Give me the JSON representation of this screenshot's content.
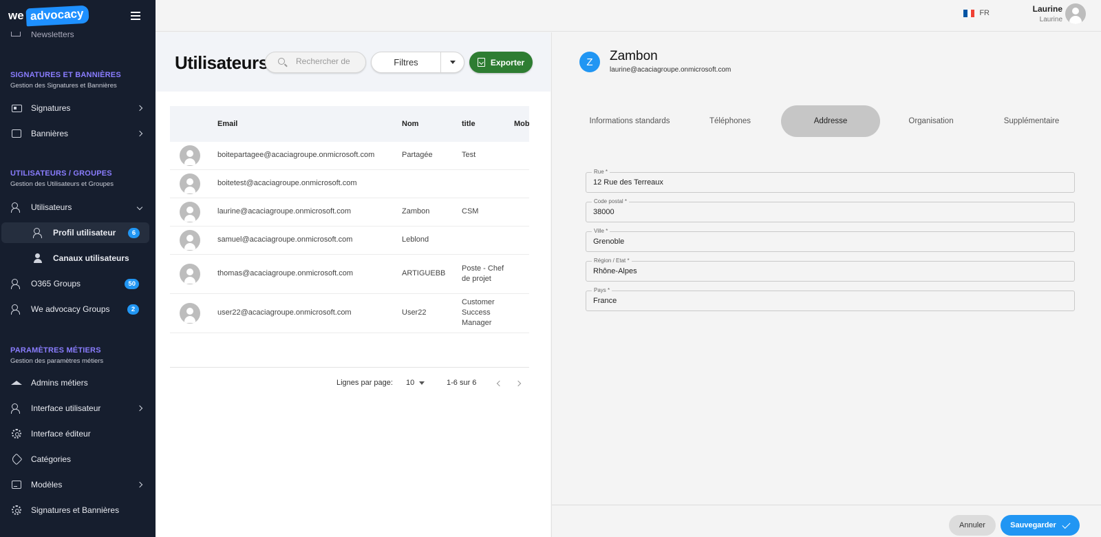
{
  "brand": {
    "we": "we",
    "advocacy": "advocacy"
  },
  "sidebar": {
    "ghost_item": "Newsletters",
    "sections": [
      {
        "heading": "SIGNATURES ET BANNIÈRES",
        "sub": "Gestion des Signatures et Bannières"
      },
      {
        "heading": "UTILISATEURS / GROUPES",
        "sub": "Gestion des Utilisateurs et Groupes"
      },
      {
        "heading": "PARAMÈTRES MÉTIERS",
        "sub": "Gestion des paramètres métiers"
      }
    ],
    "items": {
      "signatures": "Signatures",
      "bannieres": "Bannières",
      "utilisateurs": "Utilisateurs",
      "profil": "Profil utilisateur",
      "profil_badge": "6",
      "canaux": "Canaux utilisateurs",
      "o365": "O365 Groups",
      "o365_badge": "50",
      "wegroups": "We advocacy Groups",
      "wegroups_badge": "2",
      "admins": "Admins métiers",
      "interface_user": "Interface utilisateur",
      "interface_editor": "Interface éditeur",
      "categories": "Catégories",
      "modeles": "Modèles",
      "sig_ban": "Signatures et Bannières"
    }
  },
  "topbar": {
    "lang": "FR",
    "flag_colors": [
      "#0055a4",
      "#ffffff",
      "#ef4135"
    ],
    "user_name": "Laurine",
    "user_sub": "Laurine"
  },
  "list": {
    "title": "Utilisateurs",
    "search_placeholder": "Rechercher de",
    "filters_label": "Filtres",
    "export_label": "Exporter",
    "columns": [
      "Email",
      "Nom",
      "title",
      "Mobile"
    ],
    "rows": [
      {
        "email": "boitepartagee@acaciagroupe.onmicrosoft.com",
        "nom": "Partagée",
        "title": "Test"
      },
      {
        "email": "boitetest@acaciagroupe.onmicrosoft.com",
        "nom": "",
        "title": ""
      },
      {
        "email": "laurine@acaciagroupe.onmicrosoft.com",
        "nom": "Zambon",
        "title": "CSM"
      },
      {
        "email": "samuel@acaciagroupe.onmicrosoft.com",
        "nom": "Leblond",
        "title": ""
      },
      {
        "email": "thomas@acaciagroupe.onmicrosoft.com",
        "nom": "ARTIGUEBB",
        "title": "Poste - Chef de projet"
      },
      {
        "email": "user22@acaciagroupe.onmicrosoft.com",
        "nom": "User22",
        "title": "Customer Success Manager"
      }
    ],
    "pagination": {
      "rows_label": "Lignes par page:",
      "rows_value": "10",
      "range": "1-6 sur 6"
    }
  },
  "detail": {
    "initial": "Z",
    "name": "Zambon",
    "email": "laurine@acaciagroupe.onmicrosoft.com",
    "tabs": [
      "Informations standards",
      "Téléphones",
      "Addresse",
      "Organisation",
      "Supplémentaire"
    ],
    "active_tab": "Addresse",
    "fields": [
      {
        "label": "Rue *",
        "value": "12 Rue des Terreaux"
      },
      {
        "label": "Code postal *",
        "value": "38000"
      },
      {
        "label": "Ville *",
        "value": "Grenoble"
      },
      {
        "label": "Région / Etat *",
        "value": "Rhône-Alpes"
      },
      {
        "label": "Pays *",
        "value": "France"
      }
    ],
    "cancel_label": "Annuler",
    "save_label": "Sauvegarder"
  },
  "colors": {
    "accent": "#2196f3",
    "export_green": "#2e7d32",
    "sidebar_bg": "#161e2e",
    "section_heading": "#8a7dff"
  }
}
